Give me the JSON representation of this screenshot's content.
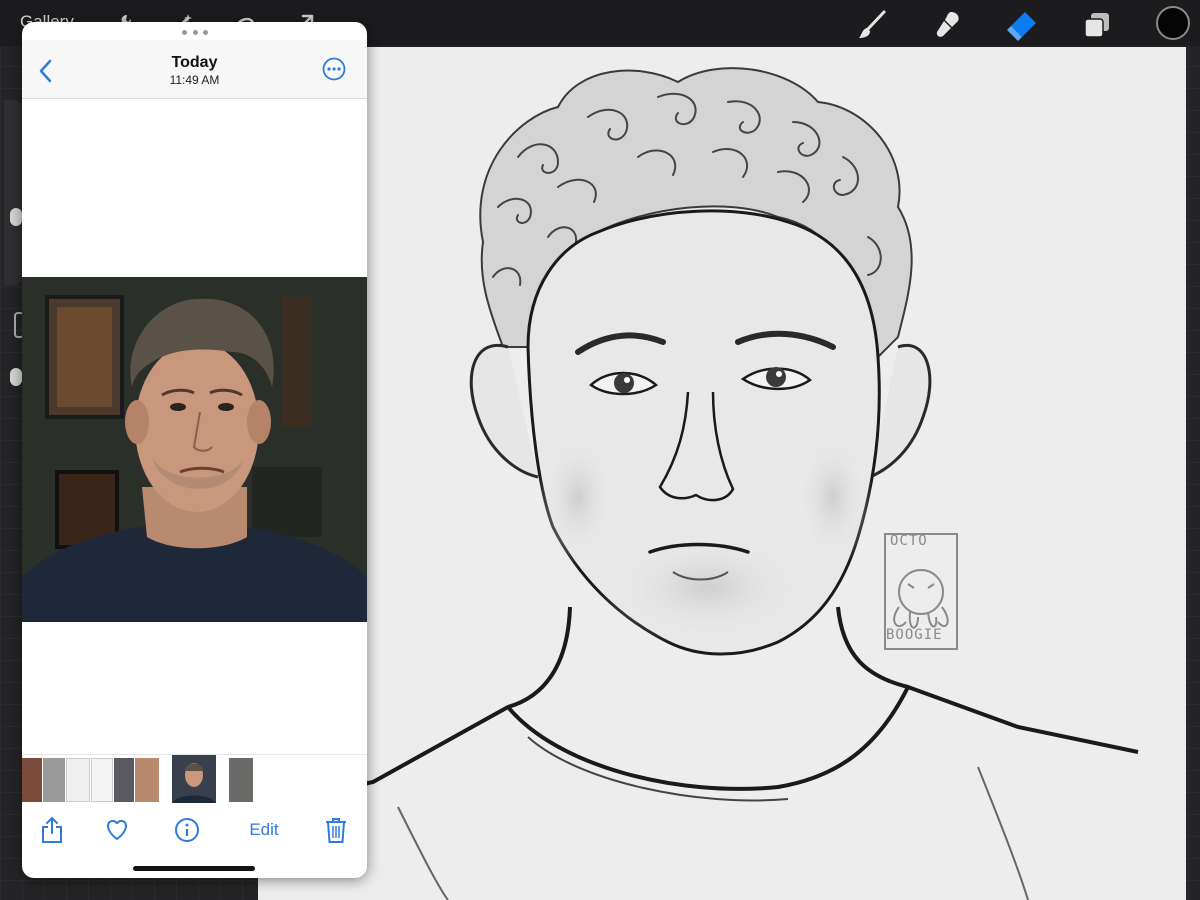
{
  "topbar": {
    "gallery_label": "Gallery",
    "left_tools": [
      "wrench-icon",
      "magic-wand-icon",
      "selection-icon",
      "transform-arrow-icon"
    ],
    "right_tools": [
      "brush-icon",
      "smudge-icon",
      "eraser-icon",
      "layers-icon"
    ],
    "active_tool": "eraser-icon",
    "active_color": "#0a7cf2",
    "current_color": "#050505"
  },
  "photos_panel": {
    "title": "Today",
    "subtitle": "11:49 AM",
    "accent_color": "#2f7bd8",
    "toolbar": {
      "share_icon": "share-icon",
      "favorite_icon": "heart-icon",
      "info_icon": "info-icon",
      "edit_label": "Edit",
      "delete_icon": "trash-icon"
    },
    "thumbnail_count": 9
  },
  "canvas": {
    "watermark": {
      "top_text": "OCTO",
      "bottom_text": "BOOGIE"
    }
  }
}
